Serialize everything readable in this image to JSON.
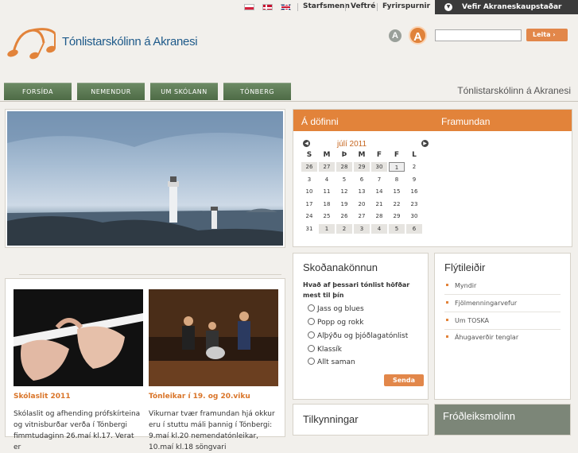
{
  "topbar": {
    "languages": [
      "Polski",
      "Dansk",
      "English"
    ],
    "links": [
      "Starfsmenn",
      "Veftré",
      "Fyrirspurnir"
    ],
    "external": "Vefir Akraneskaupstaðar"
  },
  "header": {
    "site_name": "Tónlistarskólinn á Akranesi",
    "text_small": "A",
    "text_large": "A",
    "search_placeholder": "",
    "search_button": "Leita"
  },
  "nav": {
    "tabs": [
      "FORSÍÐA",
      "NEMENDUR",
      "UM SKÓLANN",
      "TÓNBERG"
    ],
    "right_title": "Tónlistarskólinn á Akranesi"
  },
  "calendar": {
    "title": "Á döfinni",
    "upcoming": "Framundan",
    "month": "júlí 2011",
    "days": [
      "S",
      "M",
      "Þ",
      "M",
      "F",
      "F",
      "L"
    ],
    "weeks": [
      [
        "26",
        "27",
        "28",
        "29",
        "30",
        "1",
        "2"
      ],
      [
        "3",
        "4",
        "5",
        "6",
        "7",
        "8",
        "9"
      ],
      [
        "10",
        "11",
        "12",
        "13",
        "14",
        "15",
        "16"
      ],
      [
        "17",
        "18",
        "19",
        "20",
        "21",
        "22",
        "23"
      ],
      [
        "24",
        "25",
        "26",
        "27",
        "28",
        "29",
        "30"
      ],
      [
        "31",
        "1",
        "2",
        "3",
        "4",
        "5",
        "6"
      ]
    ]
  },
  "poll": {
    "title": "Skoðanakönnun",
    "question": "Hvað af þessari tónlist höfðar mest til þín",
    "options": [
      "Jass og blues",
      "Popp og rokk",
      "Alþýðu og þjóðlagatónlist",
      "Klassík",
      "Allt saman"
    ],
    "submit": "Senda"
  },
  "quicklinks": {
    "title": "Flýtileiðir",
    "items": [
      "Myndir",
      "Fjölmenningarvefur",
      "Um TOSKA",
      "Áhugaverðir tenglar"
    ]
  },
  "notices": {
    "title": "Tilkynningar"
  },
  "fact": {
    "title": "Fróðleiksmolinn"
  },
  "news": [
    {
      "title": "Skólaslit 2011",
      "text": "Skólaslit og afhending prófskírteina og vitnisburðar verða í Tónbergi fimmtudaginn 26.maí kl.17. Verat er"
    },
    {
      "title": "Tónleikar í 19. og 20.viku",
      "text": "Vikurnar tvær framundan hjá okkur eru í stuttu máli þannig í Tónbergi: 9.maí kl.20 nemendatónleikar, 10.maí kl.18 söngvari"
    }
  ]
}
